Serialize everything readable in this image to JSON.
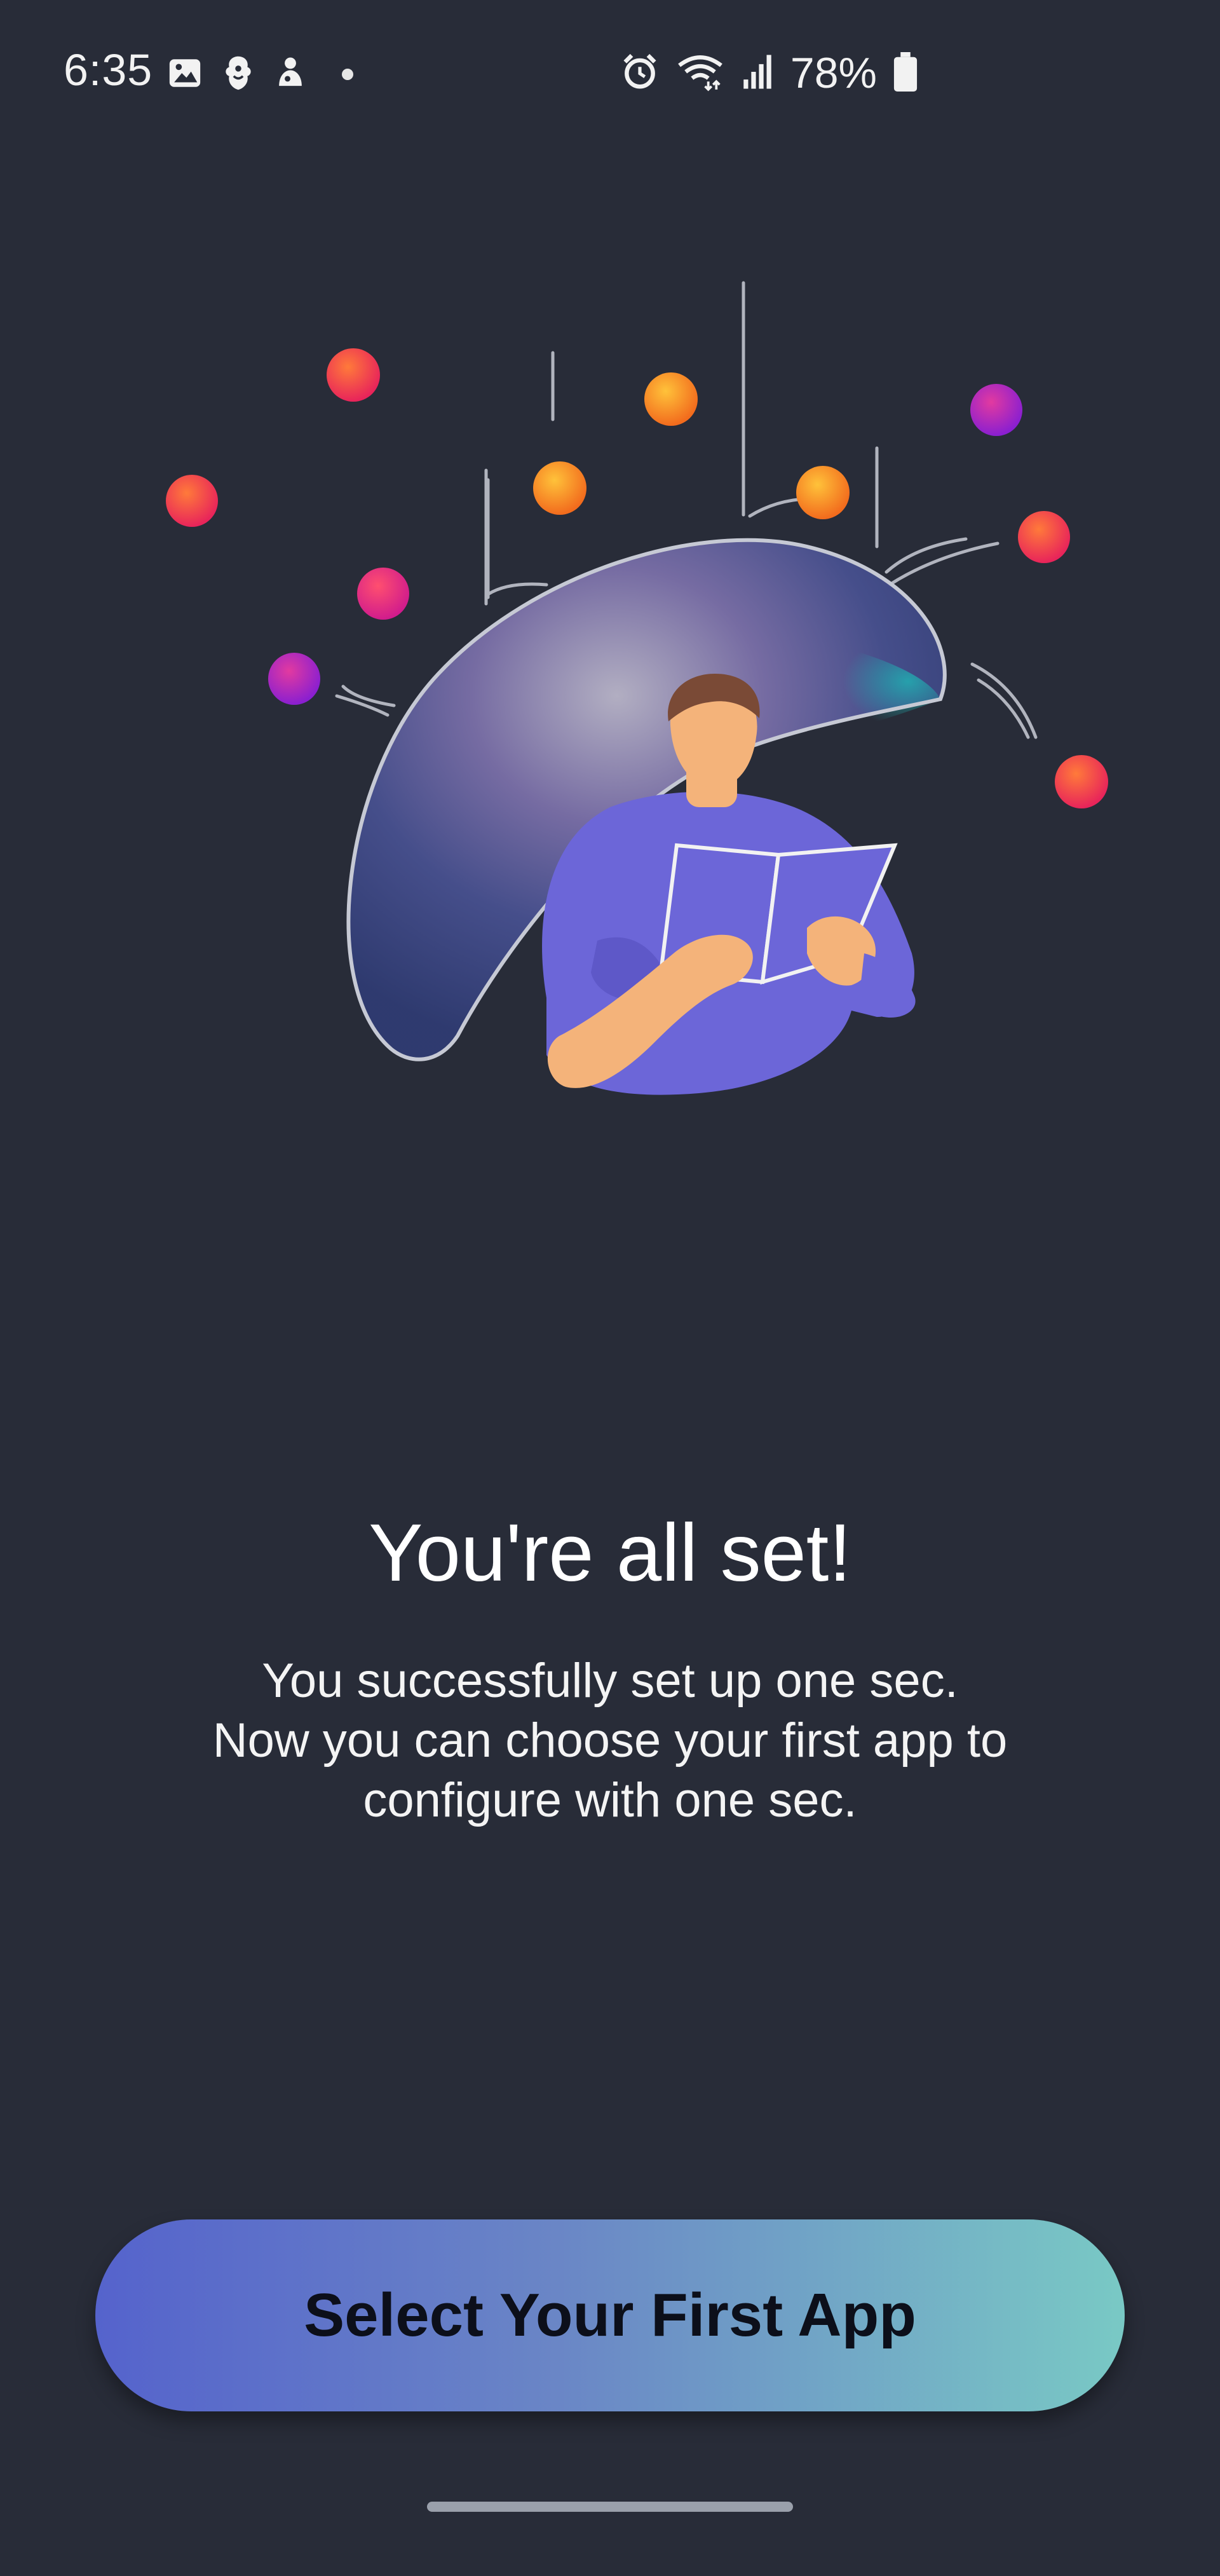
{
  "status_bar": {
    "time": "6:35",
    "battery_percent": "78%",
    "left_icons": [
      "gallery-icon",
      "premier-league-icon",
      "app-notification-icon",
      "more-dot-icon"
    ],
    "right_icons": [
      "alarm-icon",
      "wifi-icon",
      "signal-icon",
      "battery-icon"
    ]
  },
  "illustration": {
    "icon": "person-reading-under-dome-illustration"
  },
  "main": {
    "title": "You're all set!",
    "subtitle_lines": [
      "You successfully set up one sec.",
      "Now you can choose your first app to",
      "configure with one sec."
    ]
  },
  "cta": {
    "label": "Select Your First App"
  },
  "colors": {
    "background": "#282c38",
    "button_gradient_start": "#5563cc",
    "button_gradient_end": "#79c9c5",
    "button_text": "#0c0f1a"
  }
}
